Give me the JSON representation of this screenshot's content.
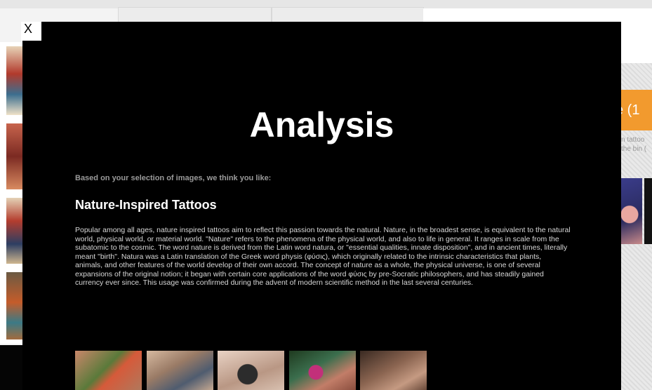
{
  "background": {
    "orange_button_text": "e (1",
    "side_text_line1": "n tattoo",
    "side_text_line2": "the bin ("
  },
  "modal": {
    "close_label": "X",
    "title": "Analysis",
    "subtitle": "Based on your selection of images, we think you like:",
    "style_name": "Nature-Inspired Tattoos",
    "description": "Popular among all ages, nature inspired tattoos aim to reflect this passion towards the natural. Nature, in the broadest sense, is equivalent to the natural world, physical world, or material world. \"Nature\" refers to the phenomena of the physical world, and also to life in general. It ranges in scale from the subatomic to the cosmic. The word nature is derived from the Latin word natura, or \"essential qualities, innate disposition\", and in ancient times, literally meant \"birth\". Natura was a Latin translation of the Greek word physis (φύσις), which originally related to the intrinsic characteristics that plants, animals, and other features of the world develop of their own accord. The concept of nature as a whole, the physical universe, is one of several expansions of the original notion; it began with certain core applications of the word φύσις by pre-Socratic philosophers, and has steadily gained currency ever since. This usage was confirmed during the advent of modern scientific method in the last several centuries.",
    "gallery_count": 5
  }
}
